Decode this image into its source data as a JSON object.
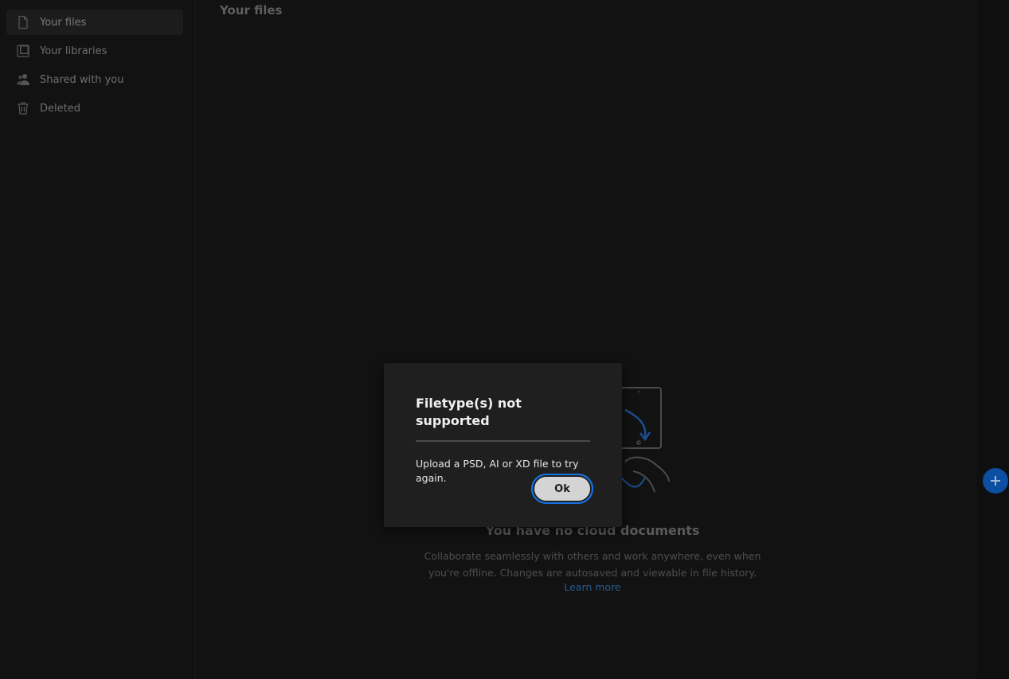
{
  "sidebar": {
    "items": [
      {
        "label": "Your files",
        "icon": "file-icon",
        "active": true
      },
      {
        "label": "Your libraries",
        "icon": "libraries-icon",
        "active": false
      },
      {
        "label": "Shared with you",
        "icon": "shared-users-icon",
        "active": false
      },
      {
        "label": "Deleted",
        "icon": "trash-icon",
        "active": false
      }
    ]
  },
  "main": {
    "title": "Your files",
    "empty_state": {
      "title": "You have no cloud documents",
      "description": "Collaborate seamlessly with others and work anywhere, even when you're offline. Changes are autosaved and viewable in file history.",
      "link": "Learn more"
    },
    "fab_icon": "plus-icon"
  },
  "dialog": {
    "title": "Filetype(s) not supported",
    "body": "Upload a PSD, AI or XD file to try again.",
    "ok_label": "Ok"
  },
  "colors": {
    "accent": "#1473e6",
    "fab": "#0b4ea2",
    "link": "#2a5a8c",
    "dialog_bg": "#1f1f1f",
    "background": "#121212"
  }
}
